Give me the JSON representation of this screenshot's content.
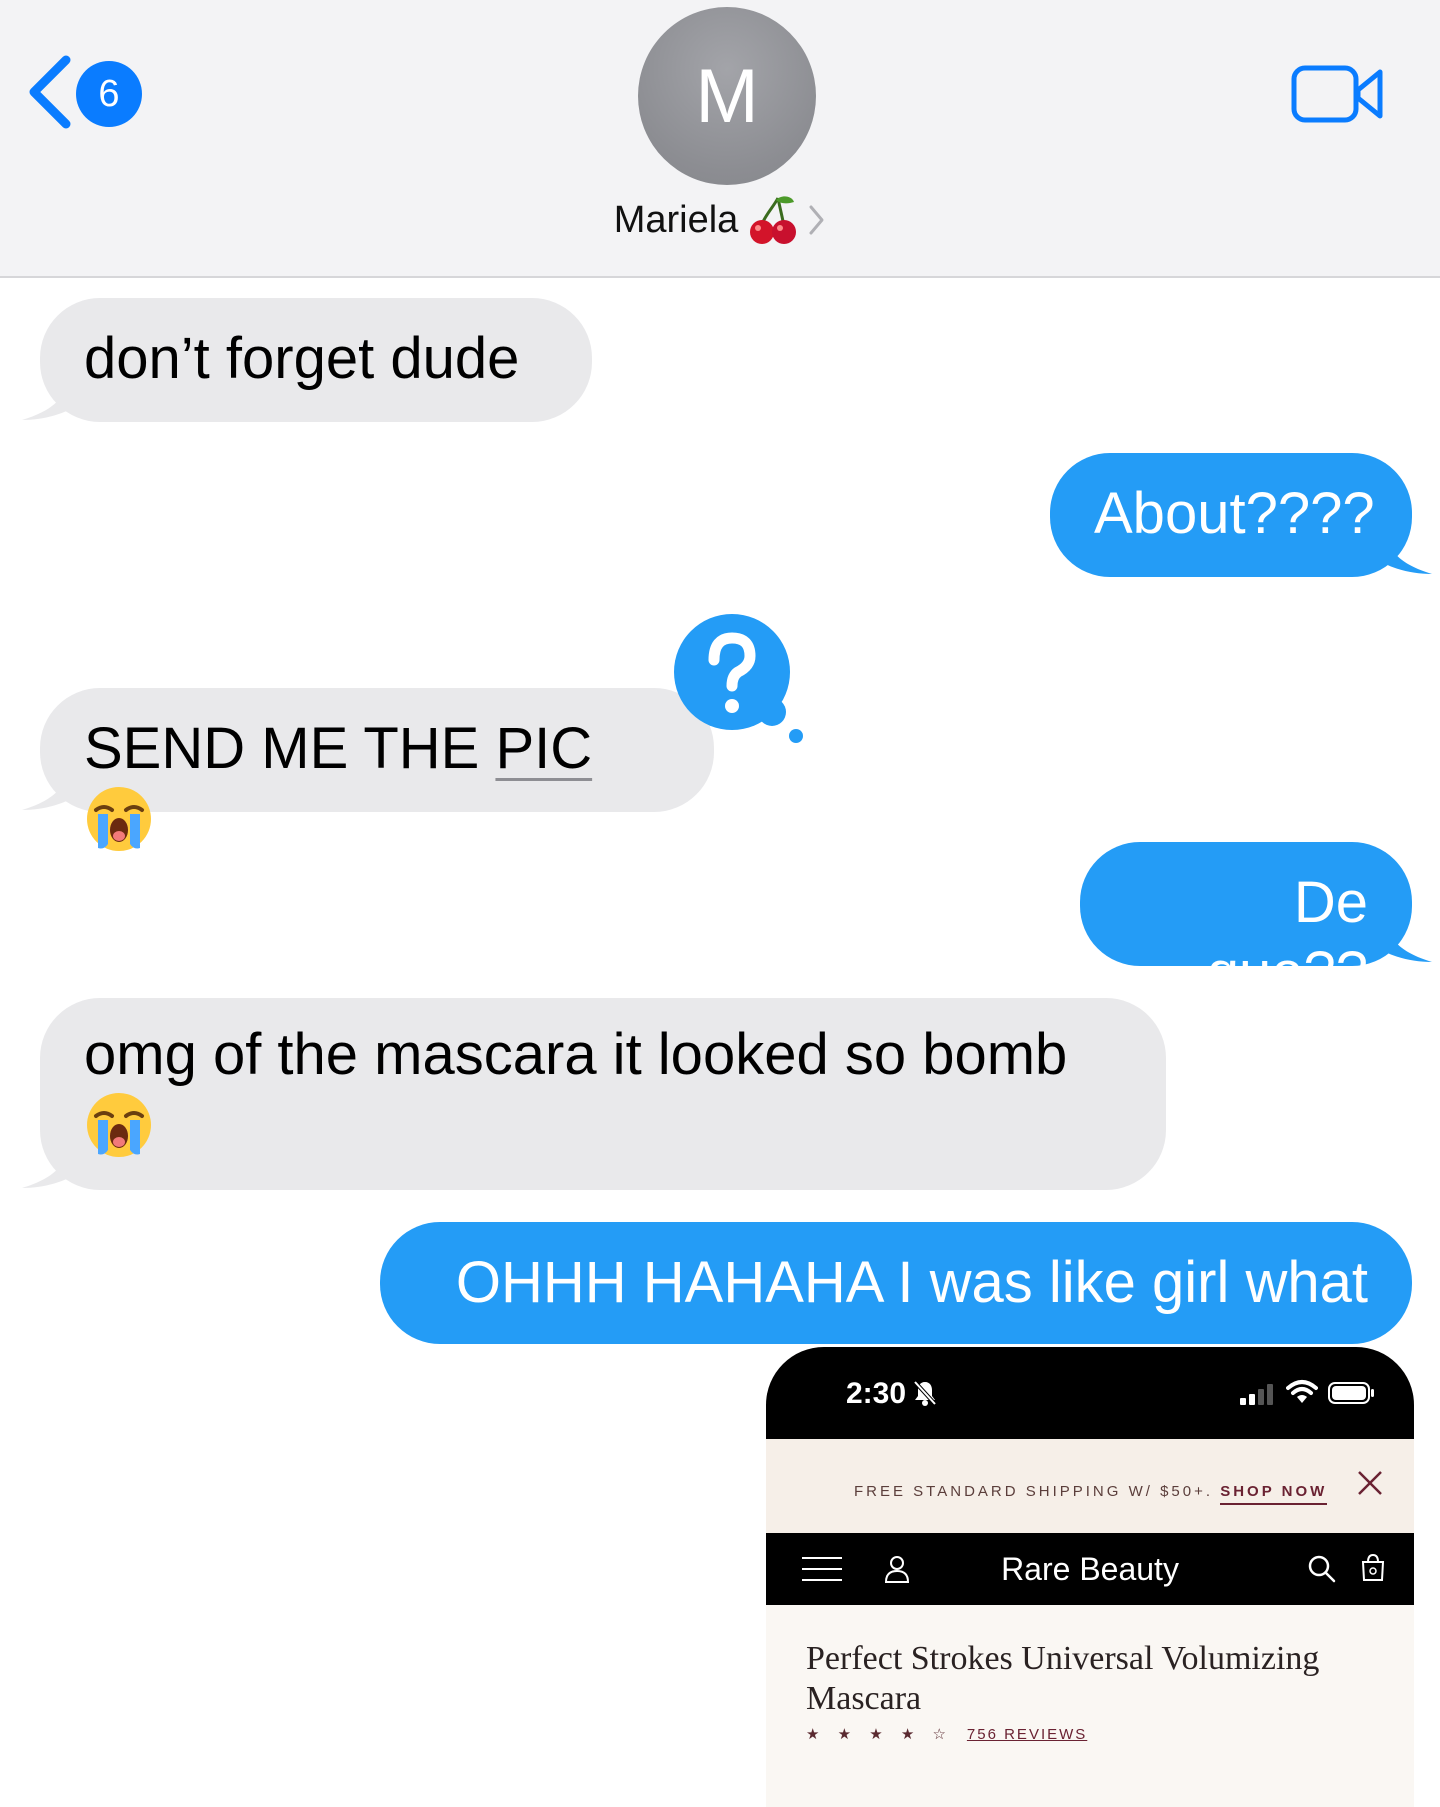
{
  "header": {
    "unread_count": "6",
    "avatar_initial": "M",
    "contact_name": "Mariela"
  },
  "messages": [
    {
      "from": "contact",
      "text": "don’t forget dude"
    },
    {
      "from": "me",
      "text": "About????"
    },
    {
      "from": "contact",
      "text_before": "SEND ME THE ",
      "text_underlined": "PIC",
      "emoji": "loudly-crying-face",
      "tapback": "question-mark"
    },
    {
      "from": "me",
      "text": "De que??"
    },
    {
      "from": "contact",
      "text": "omg of the mascara it looked so bomb",
      "emoji": "loudly-crying-face"
    },
    {
      "from": "me",
      "text": "OHHH HAHAHA I was like girl what"
    }
  ],
  "screenshot": {
    "time": "2:30",
    "banner_text": "FREE STANDARD SHIPPING W/ $50+.",
    "banner_link": "SHOP NOW",
    "brand": "Rare Beauty",
    "product_title": "Perfect Strokes Universal Volumizing Mascara",
    "stars": "★ ★ ★ ★ ☆",
    "rating": 4.5,
    "reviews": "756 REVIEWS"
  },
  "colors": {
    "sent_bubble": "#249cf6",
    "received_bubble": "#e9e9eb",
    "accent": "#0a7cff",
    "header_bg": "#f3f3f5"
  }
}
